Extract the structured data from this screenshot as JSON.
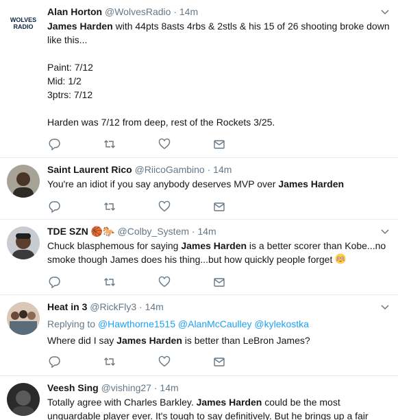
{
  "tweets": [
    {
      "name": "Alan Horton",
      "handle": "@WolvesRadio",
      "dot": "·",
      "time": "14m",
      "avatar_text_1": "WOLVES",
      "avatar_text_2": "RADIO",
      "line1_bold": "James Harden",
      "line1_rest": " with 44pts 8asts 4rbs & 2stls & his 15 of 26 shooting broke down like this...",
      "stat1": "Paint: 7/12",
      "stat2": "Mid: 1/2",
      "stat3": "3ptrs: 7/12",
      "closing": "Harden was 7/12 from deep, rest of the Rockets 3/25."
    },
    {
      "name": "Saint Laurent Rico",
      "handle": "@RiicoGambino",
      "dot": "·",
      "time": "14m",
      "text_a": "You're an idiot if you say anybody deserves MVP over ",
      "text_bold": "James Harden",
      "text_b": ""
    },
    {
      "name": "TDE SZN",
      "name_emoji": "🏀🐎",
      "handle": "@Colby_System",
      "dot": "·",
      "time": "14m",
      "text_a": "Chuck blasphemous for saying ",
      "text_bold": "James Harden",
      "text_b": " is a better scorer than Kobe...no smoke though James does his thing...but how quickly people forget "
    },
    {
      "name": "Heat in 3",
      "handle": "@RickFly3",
      "dot": "·",
      "time": "14m",
      "replying": "Replying to ",
      "reply_to": [
        "@Hawthorne1515",
        "@AlanMcCaulley",
        "@kylekostka"
      ],
      "text_a": "Where did I say ",
      "text_bold": "James Harden",
      "text_b": " is better than LeBron James?"
    },
    {
      "name": "Veesh Sing",
      "handle": "@vishing27",
      "dot": "·",
      "time": "14m",
      "text_a": "Totally agree with Charles Barkley. ",
      "text_bold": "James Harden",
      "text_b": " could be the most unguardable player ever. It's tough to say definitively. But he brings up a fair point dude can"
    }
  ],
  "actions": [
    "reply-icon",
    "retweet-icon",
    "like-icon",
    "direct-message-icon"
  ],
  "colors": {
    "link": "#1da1f2",
    "secondary": "#657786",
    "divider": "#e6ecf0",
    "icon": "#657786"
  }
}
